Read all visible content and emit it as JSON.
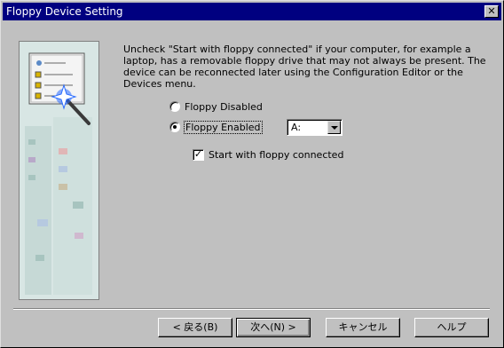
{
  "window": {
    "title": "Floppy Device Setting",
    "close_glyph": "✕",
    "close_icon": "close-icon"
  },
  "side_art": {
    "icon": "wizard-art-icon",
    "colors": {
      "panel": "#d8e6e4",
      "card": "#f4f4f4",
      "wand": "#3a3a3a",
      "sparkle": "#2a6cff"
    }
  },
  "description": "Uncheck \"Start with floppy connected\" if your computer, for example a laptop, has a removable floppy drive that may not always be present. The device can be reconnected later using the Configuration Editor or the Devices menu.",
  "options": {
    "disabled_label": "Floppy Disabled",
    "disabled_selected": false,
    "enabled_label": "Floppy Enabled",
    "enabled_selected": true
  },
  "drive_select": {
    "value": "A:",
    "icon": "chevron-down-icon"
  },
  "start_connected": {
    "label": "Start with floppy connected",
    "checked": true,
    "check_glyph": "✓"
  },
  "buttons": {
    "back": "< 戻る(B)",
    "next": "次へ(N) >",
    "cancel": "キャンセル",
    "help": "ヘルプ"
  }
}
